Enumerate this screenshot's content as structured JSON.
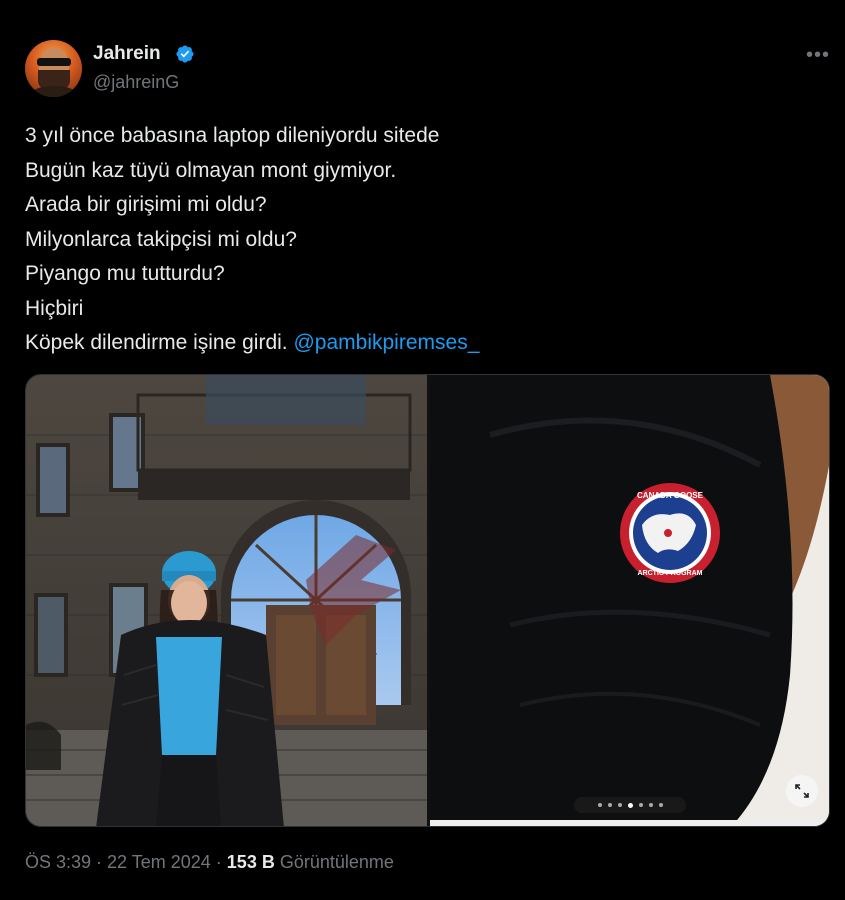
{
  "author": {
    "name": "Jahrein",
    "handle": "@jahreinG"
  },
  "icons": {
    "verified": "verified-badge-icon",
    "more": "more-options-icon",
    "expand": "expand-icon"
  },
  "colors": {
    "background": "#000000",
    "text": "#e7e9ea",
    "muted": "#71767b",
    "link": "#1d9bf0",
    "verified": "#1d9bf0"
  },
  "tweet": {
    "lines": [
      "3 yıl önce babasına laptop dileniyordu sitede",
      "Bugün kaz tüyü olmayan mont giymiyor.",
      "Arada bir girişimi mi oldu?",
      "Milyonlarca takipçisi mi oldu?",
      "Piyango mu tutturdu?",
      "Hiçbiri",
      "Köpek dilendirme işine girdi."
    ],
    "mention": "@pambikpiremses_"
  },
  "media": {
    "patch_top_text": "CANADA GOOSE",
    "patch_bottom_text": "ARCTIC PROGRAM",
    "carousel_total": 7,
    "carousel_active": 4
  },
  "meta": {
    "time": "ÖS 3:39",
    "sep1": " · ",
    "date": "22 Tem 2024",
    "sep2": " · ",
    "views_count": "153 B",
    "views_label": " Görüntülenme"
  }
}
